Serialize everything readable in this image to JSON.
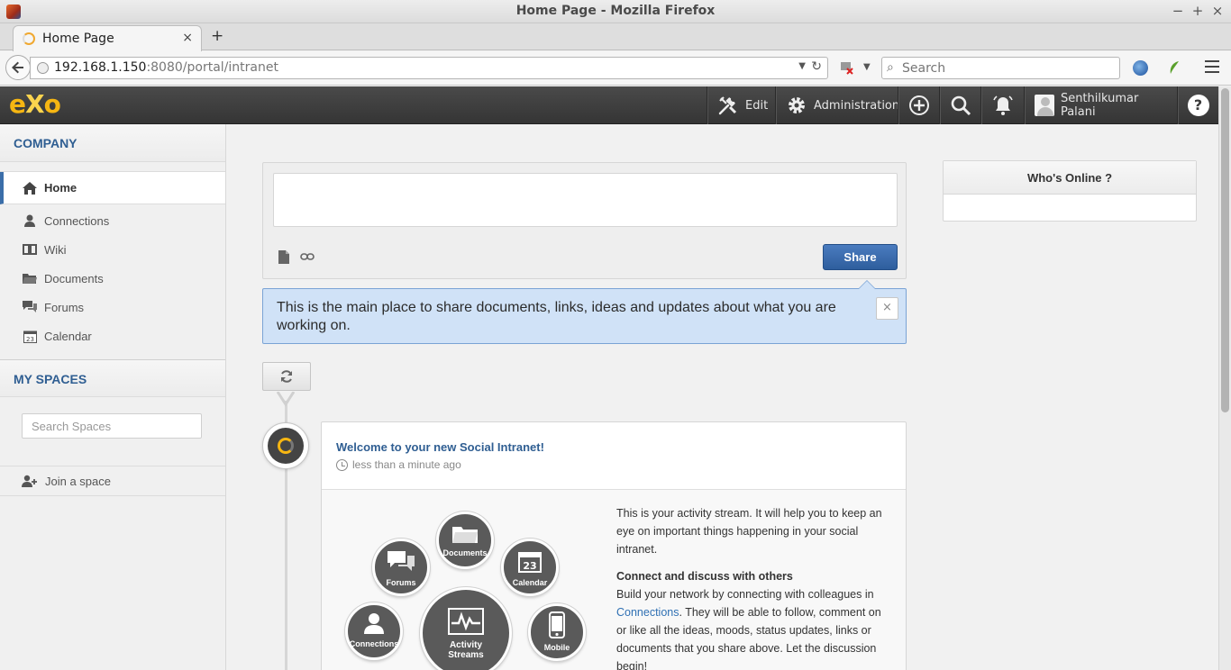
{
  "window": {
    "title": "Home Page - Mozilla Firefox",
    "minimize": "−",
    "maximize": "+",
    "close": "×"
  },
  "browser": {
    "tab_title": "Home Page",
    "tab_close": "×",
    "new_tab": "+",
    "url_host": "192.168.1.150",
    "url_rest": ":8080/portal/intranet",
    "search_placeholder": "Search"
  },
  "topbar": {
    "logo_e": "e",
    "logo_x": "X",
    "logo_o": "o",
    "edit_label": "Edit",
    "admin_label": "Administration",
    "user_name": "Senthilkumar Palani",
    "help": "?"
  },
  "sidebar": {
    "company_title": "COMPANY",
    "items": [
      {
        "label": "Home",
        "icon": "home-icon"
      },
      {
        "label": "Connections",
        "icon": "user-icon"
      },
      {
        "label": "Wiki",
        "icon": "book-icon"
      },
      {
        "label": "Documents",
        "icon": "folder-icon"
      },
      {
        "label": "Forums",
        "icon": "chat-icon"
      },
      {
        "label": "Calendar",
        "icon": "calendar-icon"
      }
    ],
    "calendar_day": "23",
    "spaces_title": "MY SPACES",
    "search_spaces_placeholder": "Search Spaces",
    "join_label": "Join a space"
  },
  "composer": {
    "share_label": "Share"
  },
  "tip": {
    "text": "This is the main place to share documents, links, ideas and updates about what you are working on.",
    "close": "×"
  },
  "activity": {
    "title": "Welcome to your new Social Intranet!",
    "time": "less than a minute ago",
    "para1": "This is your activity stream. It will help you to keep an eye on important things happening in your social intranet.",
    "sub_title": "Connect and discuss with others",
    "para2_a": "Build your network by connecting with colleagues in ",
    "para2_link": "Connections",
    "para2_b": ". They will be able to follow, comment on or like all the ideas, moods, status updates, links or documents that you share above. Let the discussion begin!",
    "bubbles": {
      "documents": "Documents",
      "forums": "Forums",
      "calendar": "Calendar",
      "calendar_day": "23",
      "connections": "Connections",
      "activity_line1": "Activity",
      "activity_line2": "Streams",
      "mobile": "Mobile"
    }
  },
  "whos_online": {
    "title": "Who's Online ?"
  },
  "colors": {
    "brand_yellow": "#f6b612",
    "link_blue": "#2f5e92",
    "share_blue": "#2e5e9d",
    "tip_bg": "#d0e2f7"
  }
}
